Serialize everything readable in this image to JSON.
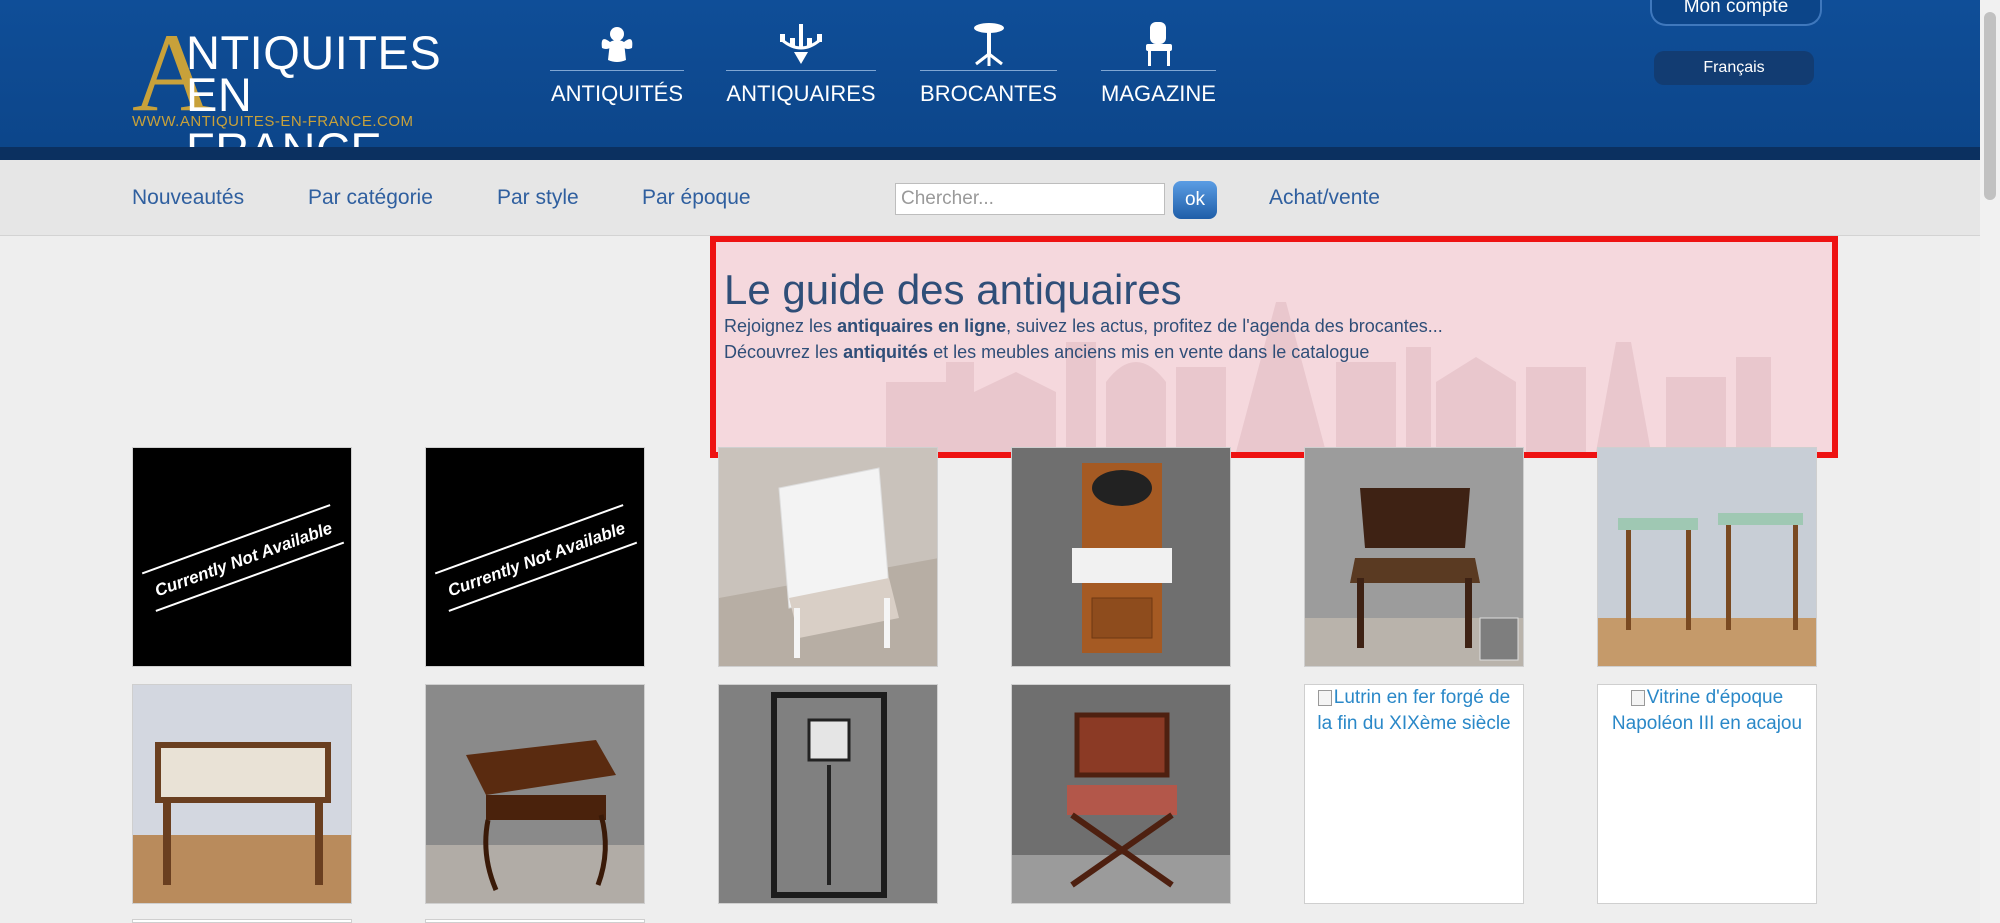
{
  "logo": {
    "line1": "NTIQUITES",
    "line2": "EN FRANCE",
    "url": "WWW.ANTIQUITES-EN-FRANCE.COM"
  },
  "nav": [
    {
      "label": "ANTIQUITÉS",
      "icon": "cherub-icon"
    },
    {
      "label": "ANTIQUAIRES",
      "icon": "chandelier-icon"
    },
    {
      "label": "BROCANTES",
      "icon": "pedestal-table-icon"
    },
    {
      "label": "MAGAZINE",
      "icon": "chair-icon"
    }
  ],
  "account": {
    "label": "Mon compte"
  },
  "language": {
    "label": "Français"
  },
  "subnav": {
    "links": [
      "Nouveautés",
      "Par catégorie",
      "Par style",
      "Par époque"
    ],
    "search_placeholder": "Chercher...",
    "ok_label": "ok",
    "buy_sell": "Achat/vente"
  },
  "hero": {
    "title": "Le guide des antiquaires",
    "line1": {
      "a": "Rejoignez les ",
      "b": "antiquaires en ligne",
      "c": ", suivez les actus, profitez de l'agenda des brocantes..."
    },
    "line2": {
      "a": "Découvrez les ",
      "b": "antiquités",
      "c": " et les meubles anciens mis en vente dans le catalogue"
    }
  },
  "listings": {
    "unavailable_text": "Currently Not Available",
    "alt_texts": [
      "Lutrin en fer forgé de la fin du XIXème siècle",
      "Vitrine d'époque Napoléon III en acajou"
    ]
  },
  "colors": {
    "header_blue": "#0f4e98",
    "gold": "#c8a13a",
    "link_blue": "#2f5f9f",
    "highlight_red": "#ee1212"
  }
}
